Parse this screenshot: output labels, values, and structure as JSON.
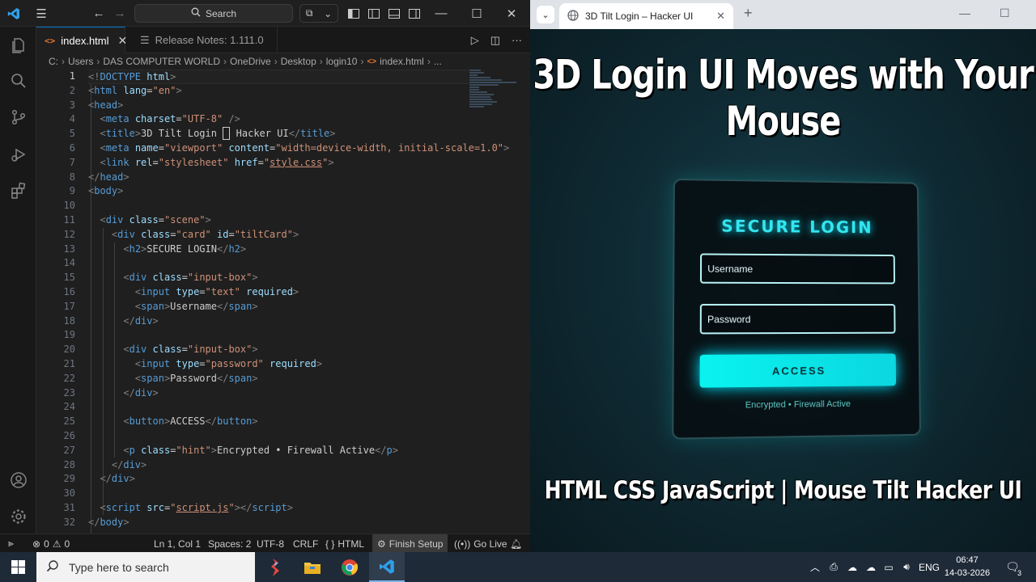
{
  "vscode": {
    "search_label": "Search",
    "tabs": [
      {
        "label": "index.html",
        "active": true
      },
      {
        "label": "Release Notes: 1.111.0",
        "active": false
      }
    ],
    "breadcrumb": [
      "C:",
      "Users",
      "DAS COMPUTER WORLD",
      "OneDrive",
      "Desktop",
      "login10",
      "index.html",
      "..."
    ],
    "line_numbers": [
      "1",
      "2",
      "3",
      "4",
      "5",
      "6",
      "7",
      "8",
      "9",
      "10",
      "11",
      "12",
      "13",
      "14",
      "15",
      "16",
      "17",
      "18",
      "19",
      "20",
      "21",
      "22",
      "23",
      "24",
      "25",
      "26",
      "27",
      "28",
      "29",
      "30",
      "31",
      "32"
    ],
    "code": {
      "l6_title": "3D Tilt Login ",
      "l6_title2": " Hacker UI",
      "l13": "SECURE LOGIN",
      "l17": "Username",
      "l22": "Password",
      "l25": "ACCESS",
      "l27": "Encrypted • Firewall Active"
    },
    "status": {
      "errors": "0",
      "warnings": "0",
      "position": "Ln 1, Col 1",
      "spaces": "Spaces: 2",
      "encoding": "UTF-8",
      "eol": "CRLF",
      "language": "HTML",
      "finish_setup": "Finish Setup",
      "go_live": "Go Live"
    }
  },
  "browser": {
    "tab_title": "3D Tilt Login – Hacker UI",
    "headline": "3D Login UI Moves with Your Mouse",
    "subline": "HTML CSS JavaScript | Mouse Tilt Hacker UI",
    "card": {
      "title": "SECURE LOGIN",
      "username_placeholder": "Username",
      "password_placeholder": "Password",
      "button": "ACCESS",
      "hint": "Encrypted • Firewall Active"
    }
  },
  "taskbar": {
    "search_placeholder": "Type here to search",
    "language": "ENG",
    "time": "06:47",
    "date": "14-03-2026",
    "notifications": "3"
  },
  "colors": {
    "vscode_bg": "#1f1f1f",
    "accent_blue": "#0078d4",
    "neon_cyan": "#00e5ff"
  }
}
